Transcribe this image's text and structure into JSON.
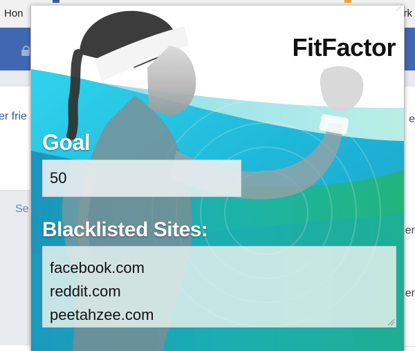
{
  "browser": {
    "bookmarks_left": "Hon",
    "bookmarks_right": "rk",
    "page_left_text": "er frie",
    "page_see_text": "Se",
    "page_right_text_1": "e",
    "page_right_text_2": "er",
    "page_right_text_3": "er"
  },
  "popup": {
    "brand": "FitFactor",
    "goal": {
      "label": "Goal",
      "value": "50"
    },
    "blacklist": {
      "label": "Blacklisted Sites:",
      "value": "facebook.com\nreddit.com\npeetahzee.com"
    }
  },
  "colors": {
    "facebook_header": "#4267b2",
    "wave_cyan": "#1fc8e6",
    "wave_green": "#22b573",
    "brand_text": "#111111",
    "label_text": "#ffffff"
  },
  "icons": {
    "lock": "lock-icon",
    "resize_grip": "resize-grip-icon"
  }
}
